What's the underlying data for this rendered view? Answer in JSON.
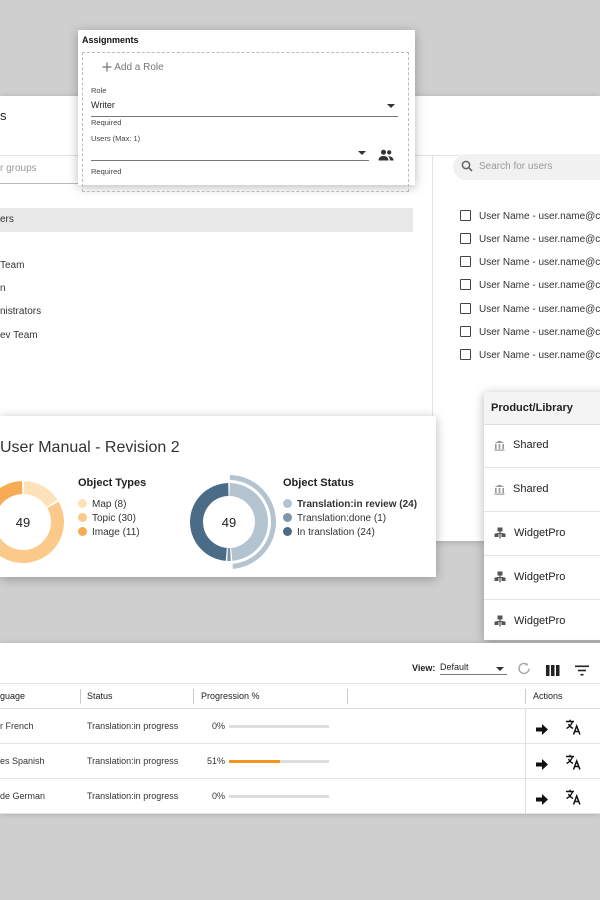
{
  "users_panel": {
    "title_fragment": "s",
    "group_search_placeholder": "r groups",
    "groups": [
      "ers",
      "Team",
      "n",
      "nistrators",
      "ev Team"
    ],
    "user_search_placeholder": "Search for users",
    "users": [
      "User Name - user.name@con",
      "User Name - user.name@con",
      "User Name - user.name@con",
      "User Name - user.name@con",
      "User Name - user.name@con",
      "User Name - user.name@con",
      "User Name - user.name@con"
    ]
  },
  "assignments": {
    "title": "Assignments",
    "add_role": "Add a Role",
    "role_label": "Role",
    "role_value": "Writer",
    "role_helper": "Required",
    "users_label": "Users (Max: 1)",
    "users_helper": "Required"
  },
  "dashboard": {
    "title": "User Manual - Revision 2",
    "object_types": {
      "title": "Object Types",
      "total": "49",
      "items": [
        {
          "label": "Map (8)",
          "value": 8,
          "color": "#fde1b8"
        },
        {
          "label": "Topic (30)",
          "value": 30,
          "color": "#fbc98a"
        },
        {
          "label": "Image (11)",
          "value": 11,
          "color": "#f7ab55"
        }
      ]
    },
    "object_status": {
      "title": "Object Status",
      "total": "49",
      "items": [
        {
          "label": "Translation:in review (24)",
          "value": 24,
          "color": "#b3c3cf"
        },
        {
          "label": "Translation:done (1)",
          "value": 1,
          "color": "#7d96aa"
        },
        {
          "label": "In translation (24)",
          "value": 24,
          "color": "#4b6c86"
        }
      ]
    }
  },
  "product_library": {
    "header": "Product/Library",
    "rows": [
      {
        "label": "Shared",
        "icon": "library-icon"
      },
      {
        "label": "Shared",
        "icon": "library-icon"
      },
      {
        "label": "WidgetPro",
        "icon": "product-icon"
      },
      {
        "label": "WidgetPro",
        "icon": "product-icon"
      },
      {
        "label": "WidgetPro",
        "icon": "product-icon"
      }
    ]
  },
  "translation_table": {
    "view_label": "View:",
    "view_value": "Default",
    "columns": [
      "guage",
      "Status",
      "Progression %",
      "Actions"
    ],
    "rows": [
      {
        "language": "r French",
        "status": "Translation:in progress",
        "progress_label": "0%",
        "progress": 0
      },
      {
        "language": "es Spanish",
        "status": "Translation:in progress",
        "progress_label": "51%",
        "progress": 51
      },
      {
        "language": "de German",
        "status": "Translation:in progress",
        "progress_label": "0%",
        "progress": 0
      }
    ]
  },
  "colors": {
    "accent": "#f7941d",
    "status_dark": "#4b6c86"
  }
}
